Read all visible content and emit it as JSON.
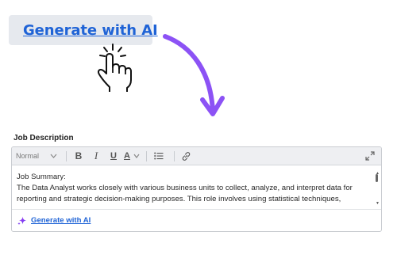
{
  "hero": {
    "generate_label": "Generate with AI",
    "icon": "sparkle-icon",
    "cursor_icon": "hand-pointer-icon",
    "arrow_icon": "curved-arrow-down-icon"
  },
  "field": {
    "label": "Job Description"
  },
  "toolbar": {
    "format_value": "Normal",
    "bold": "B",
    "italic": "I",
    "underline": "U",
    "text_color": "A",
    "list_icon": "list-icon",
    "link_icon": "link-icon",
    "expand_icon": "expand-icon"
  },
  "editor": {
    "lines": [
      "Job Summary:",
      "The Data Analyst works closely with various business units to collect, analyze, and interpret data for",
      "reporting and strategic decision-making purposes. This role involves using statistical techniques,"
    ]
  },
  "footer": {
    "generate_label": "Generate with AI"
  },
  "colors": {
    "link": "#1f63d6",
    "sparkle": "#8a2be2",
    "arrow": "#8c52f5"
  }
}
